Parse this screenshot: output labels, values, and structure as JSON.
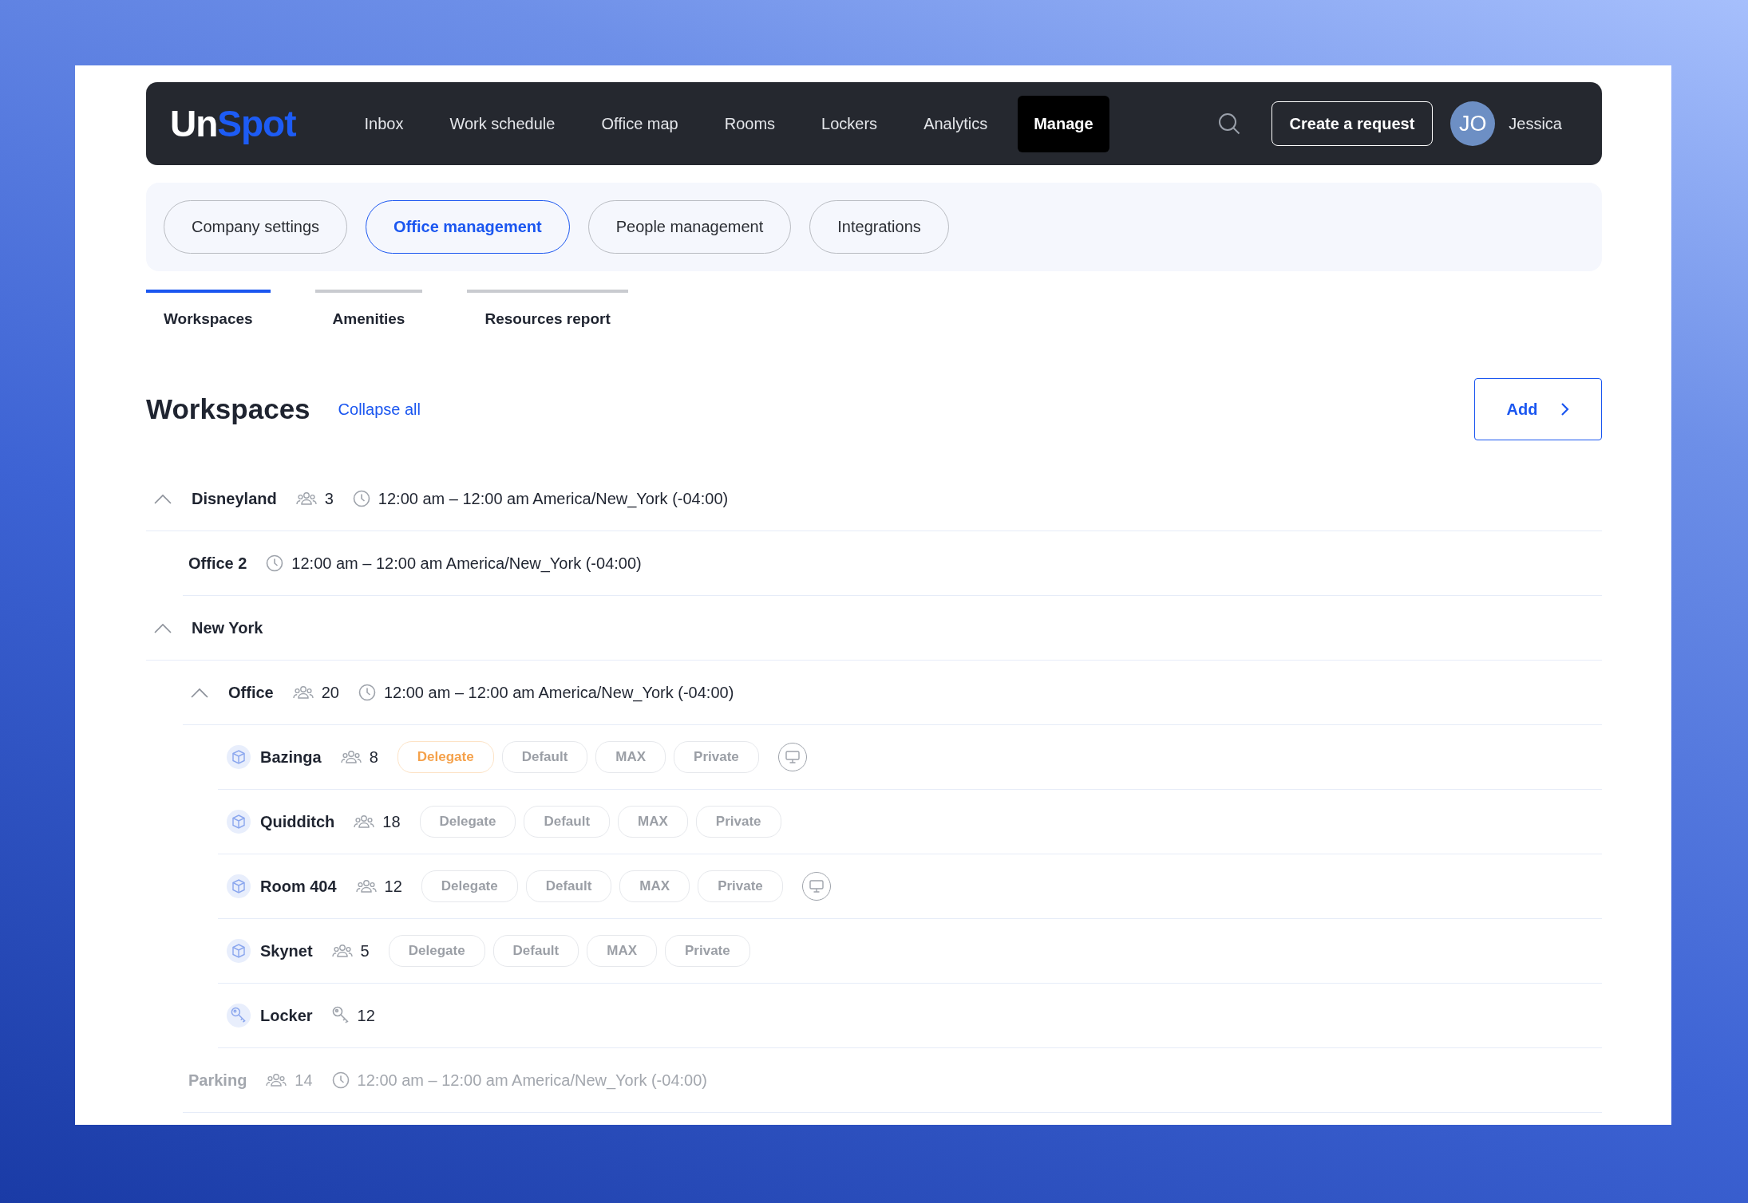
{
  "logo": {
    "prefix": "Un",
    "suffix": "Spot"
  },
  "nav": [
    {
      "label": "Inbox",
      "selected": false
    },
    {
      "label": "Work schedule",
      "selected": false
    },
    {
      "label": "Office map",
      "selected": false
    },
    {
      "label": "Rooms",
      "selected": false
    },
    {
      "label": "Lockers",
      "selected": false
    },
    {
      "label": "Analytics",
      "selected": false
    },
    {
      "label": "Manage",
      "selected": true
    }
  ],
  "create_button": "Create a request",
  "user": {
    "initials": "JO",
    "name": "Jessica"
  },
  "section_tabs": [
    {
      "label": "Company settings",
      "selected": false
    },
    {
      "label": "Office management",
      "selected": true
    },
    {
      "label": "People management",
      "selected": false
    },
    {
      "label": "Integrations",
      "selected": false
    }
  ],
  "tabs": [
    {
      "label": "Workspaces",
      "selected": true
    },
    {
      "label": "Amenities",
      "selected": false
    },
    {
      "label": "Resources report",
      "selected": false
    }
  ],
  "heading": "Workspaces",
  "collapse_link": "Collapse all",
  "add_button": "Add",
  "tree": [
    {
      "name": "Disneyland",
      "expanded": true,
      "disabled": false,
      "people": "3",
      "hours": "12:00 am – 12:00 am America/New_York (-04:00)",
      "children": [
        {
          "name": "Office 2",
          "disabled": false,
          "hours": "12:00 am – 12:00 am America/New_York (-04:00)"
        }
      ]
    },
    {
      "name": "New York",
      "expanded": true,
      "disabled": false,
      "children": [
        {
          "name": "Office",
          "expanded": true,
          "disabled": false,
          "people": "20",
          "hours": "12:00 am – 12:00 am America/New_York (-04:00)",
          "children": [
            {
              "kind": "room",
              "name": "Bazinga",
              "disabled": false,
              "people": "8",
              "display": true,
              "tags": [
                {
                  "label": "Delegate",
                  "on": true
                },
                {
                  "label": "Default",
                  "on": false
                },
                {
                  "label": "MAX",
                  "on": false
                },
                {
                  "label": "Private",
                  "on": false
                }
              ]
            },
            {
              "kind": "room",
              "name": "Quidditch",
              "disabled": false,
              "people": "18",
              "display": false,
              "tags": [
                {
                  "label": "Delegate",
                  "on": false
                },
                {
                  "label": "Default",
                  "on": false
                },
                {
                  "label": "MAX",
                  "on": false
                },
                {
                  "label": "Private",
                  "on": false
                }
              ]
            },
            {
              "kind": "room",
              "name": "Room 404",
              "disabled": false,
              "people": "12",
              "display": true,
              "tags": [
                {
                  "label": "Delegate",
                  "on": false
                },
                {
                  "label": "Default",
                  "on": false
                },
                {
                  "label": "MAX",
                  "on": false
                },
                {
                  "label": "Private",
                  "on": false
                }
              ]
            },
            {
              "kind": "room",
              "name": "Skynet",
              "disabled": false,
              "people": "5",
              "display": false,
              "tags": [
                {
                  "label": "Delegate",
                  "on": false
                },
                {
                  "label": "Default",
                  "on": false
                },
                {
                  "label": "MAX",
                  "on": false
                },
                {
                  "label": "Private",
                  "on": false
                }
              ]
            },
            {
              "kind": "locker",
              "name": "Locker",
              "disabled": false,
              "keys": "12"
            }
          ]
        },
        {
          "name": "Parking",
          "disabled": true,
          "people": "14",
          "hours": "12:00 am – 12:00 am America/New_York (-04:00)"
        }
      ]
    }
  ]
}
